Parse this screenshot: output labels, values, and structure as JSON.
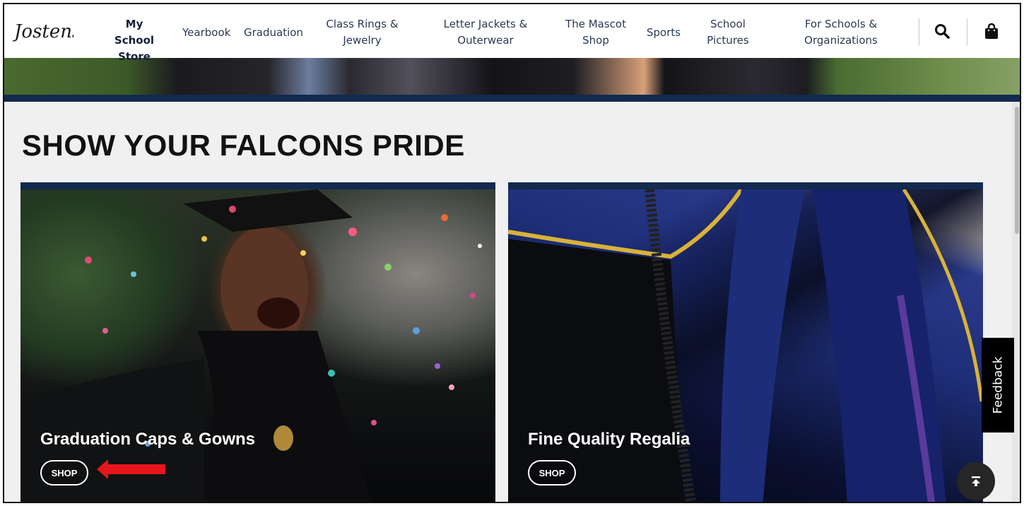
{
  "brand": {
    "logo_text": "Jostens"
  },
  "nav": {
    "my_school_store_l1": "My School",
    "my_school_store_l2": "Store",
    "yearbook": "Yearbook",
    "graduation": "Graduation",
    "class_rings_l1": "Class Rings &",
    "class_rings_l2": "Jewelry",
    "letter_jackets_l1": "Letter Jackets &",
    "letter_jackets_l2": "Outerwear",
    "mascot_l1": "The Mascot",
    "mascot_l2": "Shop",
    "sports": "Sports",
    "school_pictures_l1": "School",
    "school_pictures_l2": "Pictures",
    "for_schools_l1": "For Schools &",
    "for_schools_l2": "Organizations"
  },
  "icons": {
    "search": "search-icon",
    "cart": "shopping-bag-icon",
    "back_to_top": "arrow-to-top-icon"
  },
  "section": {
    "title": "SHOW YOUR FALCONS PRIDE"
  },
  "cards": [
    {
      "title": "Graduation Caps & Gowns",
      "button": "SHOP"
    },
    {
      "title": "Fine Quality Regalia",
      "button": "SHOP"
    }
  ],
  "feedback": {
    "label": "Feedback"
  },
  "colors": {
    "navy": "#132a4e",
    "annotation_red": "#e8161b"
  }
}
